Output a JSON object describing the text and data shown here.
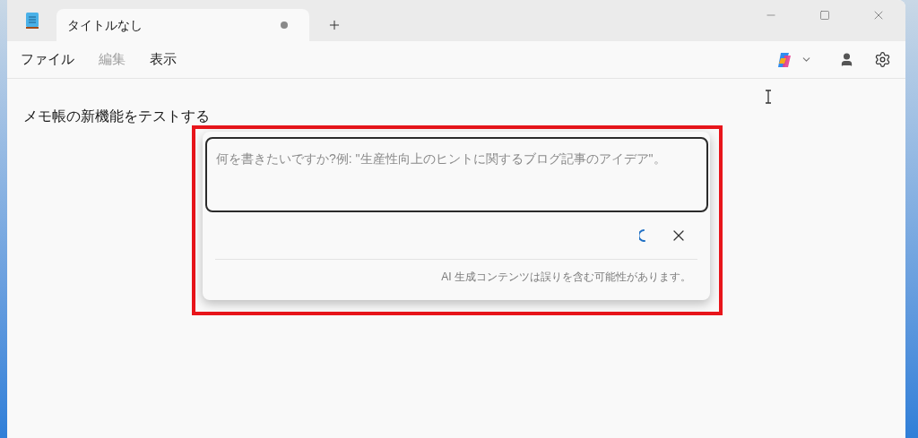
{
  "tab": {
    "title": "タイトルなし",
    "unsaved": true
  },
  "menu": [
    {
      "label": "ファイル",
      "disabled": false
    },
    {
      "label": "編集",
      "disabled": true
    },
    {
      "label": "表示",
      "disabled": false
    }
  ],
  "document": {
    "text": "メモ帳の新機能をテストする"
  },
  "rewrite_popup": {
    "placeholder": "何を書きたいですか?例: \"生産性向上のヒントに関するブログ記事のアイデア\"。",
    "loading": true,
    "disclaimer": "AI 生成コンテンツは誤りを含む可能性があります。"
  }
}
